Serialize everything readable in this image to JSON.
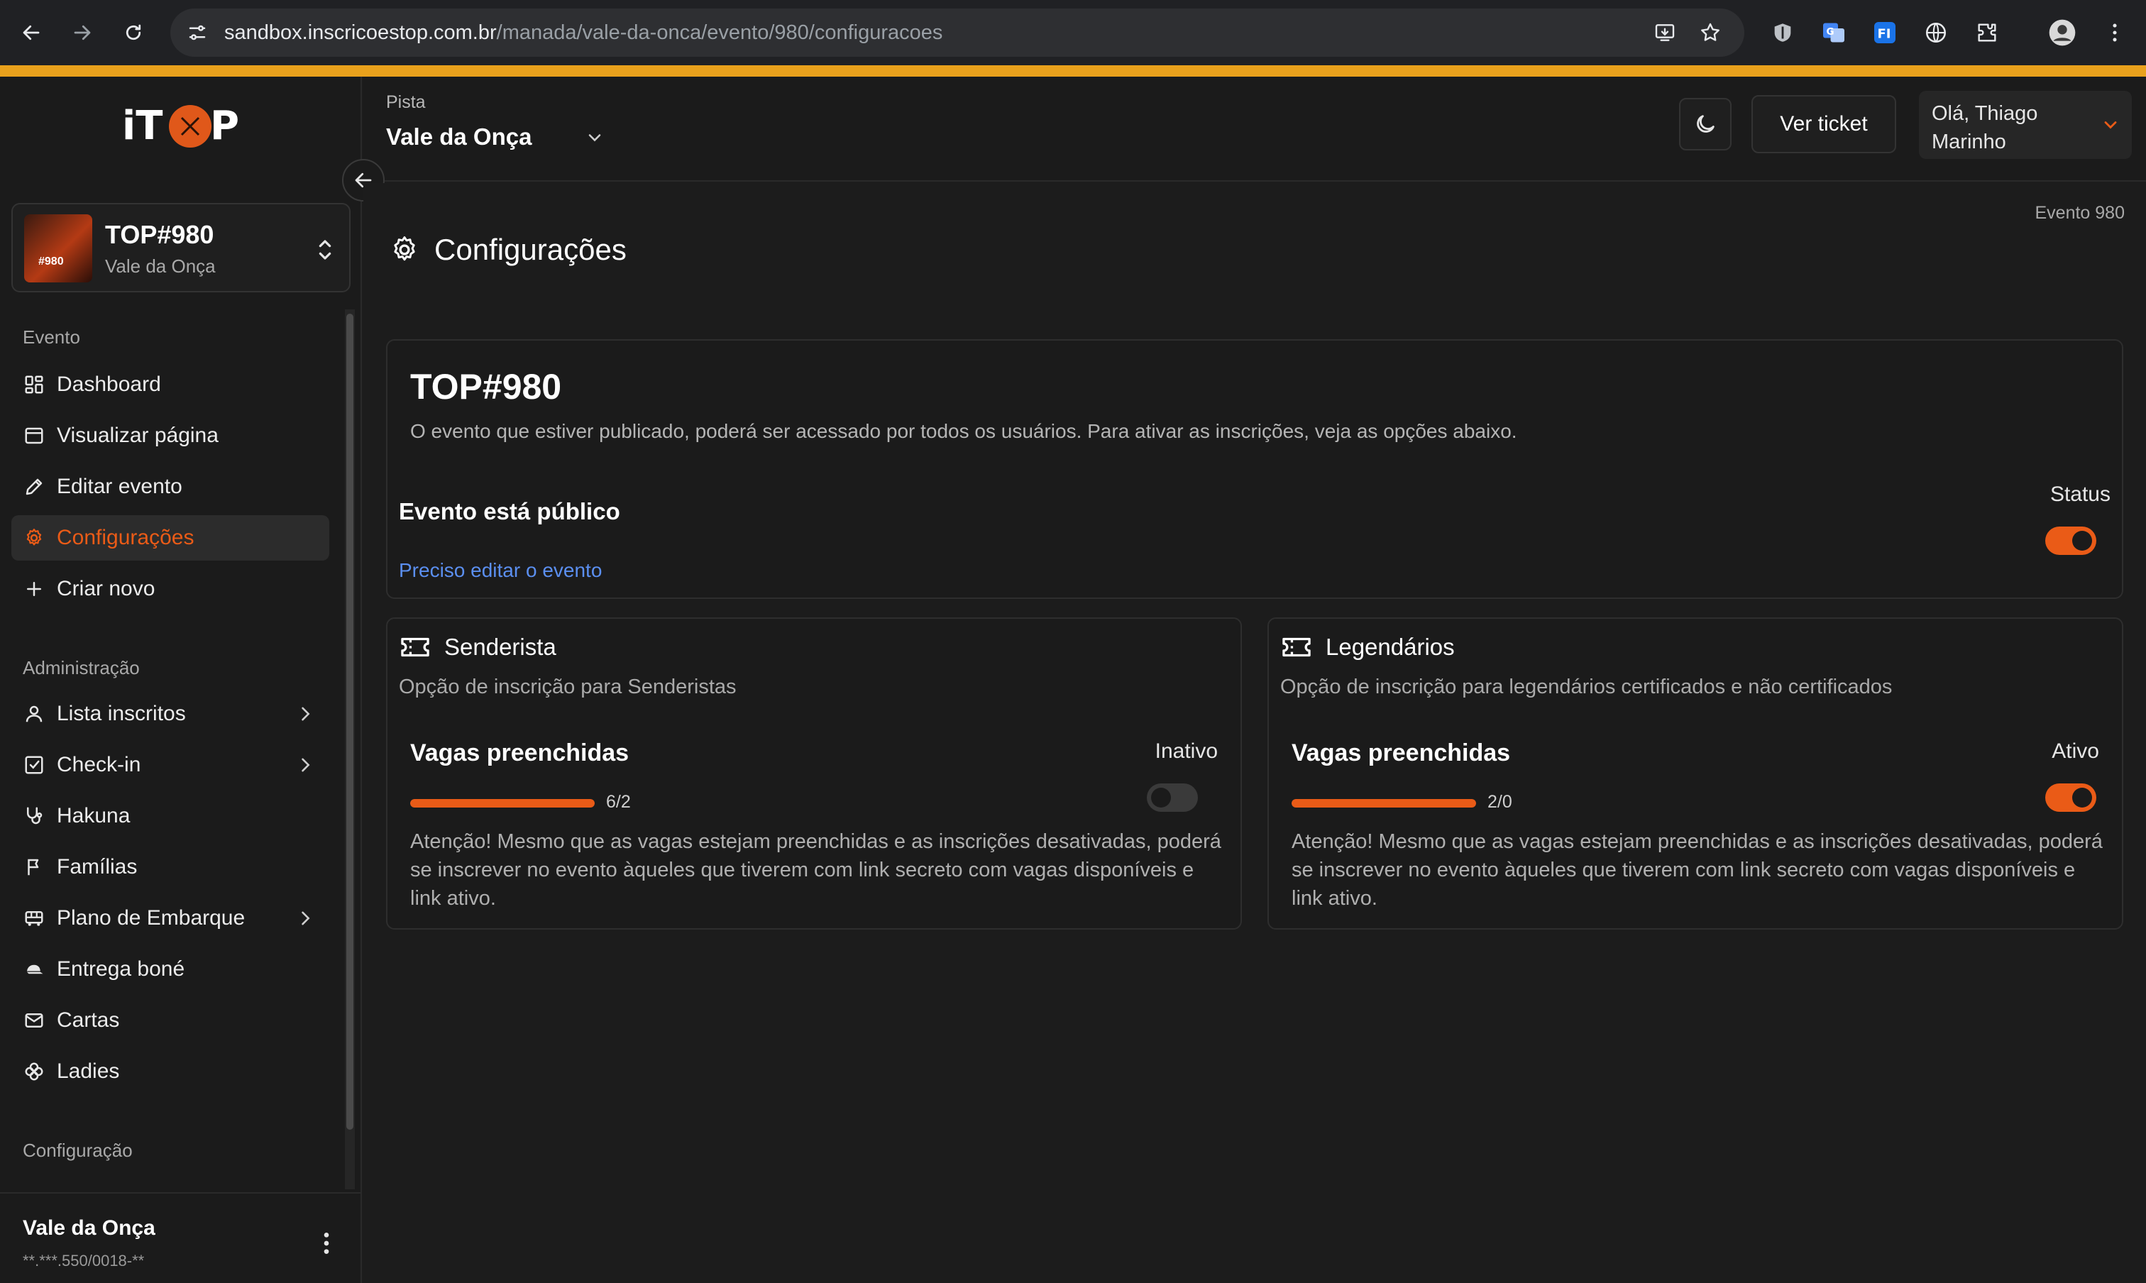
{
  "browser": {
    "url_host": "sandbox.inscricoestop.com.br",
    "url_path": "/manada/vale-da-onca/evento/980/configuracoes"
  },
  "sidebar": {
    "logo": "iTOP",
    "event": {
      "name": "TOP#980",
      "subtitle": "Vale da Onça",
      "thumb_text": "#980"
    },
    "sections": {
      "evento": "Evento",
      "administracao": "Administração",
      "configuracao": "Configuração"
    },
    "evento_items": [
      {
        "label": "Dashboard",
        "icon": "grid-icon"
      },
      {
        "label": "Visualizar página",
        "icon": "browser-icon"
      },
      {
        "label": "Editar evento",
        "icon": "pencil-icon"
      },
      {
        "label": "Configurações",
        "icon": "gear-icon",
        "active": true
      },
      {
        "label": "Criar novo",
        "icon": "plus-icon"
      }
    ],
    "admin_items": [
      {
        "label": "Lista inscritos",
        "icon": "user-icon",
        "chevron": true
      },
      {
        "label": "Check-in",
        "icon": "checkbox-icon",
        "chevron": true
      },
      {
        "label": "Hakuna",
        "icon": "stethoscope-icon"
      },
      {
        "label": "Famílias",
        "icon": "flag-icon"
      },
      {
        "label": "Plano de Embarque",
        "icon": "bus-icon",
        "chevron": true
      },
      {
        "label": "Entrega boné",
        "icon": "cap-icon"
      },
      {
        "label": "Cartas",
        "icon": "mail-icon"
      },
      {
        "label": "Ladies",
        "icon": "flower-icon"
      }
    ],
    "footer": {
      "name": "Vale da Onça",
      "doc": "**.***.550/0018-**"
    }
  },
  "topbar": {
    "pista_label": "Pista",
    "pista_value": "Vale da Onça",
    "ticket_label": "Ver ticket",
    "user_label": "Olá, Thiago Marinho"
  },
  "main": {
    "event_id": "Evento 980",
    "page_title": "Configurações",
    "publish": {
      "title": "TOP#980",
      "description": "O evento que estiver publicado, poderá ser acessado por todos os usuários. Para ativar as inscrições, veja as opções abaixo.",
      "row_title": "Evento está público",
      "link": "Preciso editar o evento",
      "status_label": "Status",
      "status_on": true
    },
    "options": [
      {
        "title": "Senderista",
        "description": "Opção de inscrição para Senderistas",
        "vagas_title": "Vagas preenchidas",
        "state_label": "Inativo",
        "active": false,
        "count": "6/2",
        "fill": 1.0,
        "note": "Atenção! Mesmo que as vagas estejam preenchidas e as inscrições desativadas, poderá se inscrever no evento àqueles que tiverem com link secreto com vagas disponíveis e link ativo."
      },
      {
        "title": "Legendários",
        "description": "Opção de inscrição para legendários certificados e não certificados",
        "vagas_title": "Vagas preenchidas",
        "state_label": "Ativo",
        "active": true,
        "count": "2/0",
        "fill": 1.0,
        "note": "Atenção! Mesmo que as vagas estejam preenchidas e as inscrições desativadas, poderá se inscrever no evento àqueles que tiverem com link secreto com vagas disponíveis e link ativo."
      }
    ]
  },
  "colors": {
    "accent": "#ea5b17",
    "link": "#5b8ff0",
    "chrome_strip": "#e9a11c"
  }
}
